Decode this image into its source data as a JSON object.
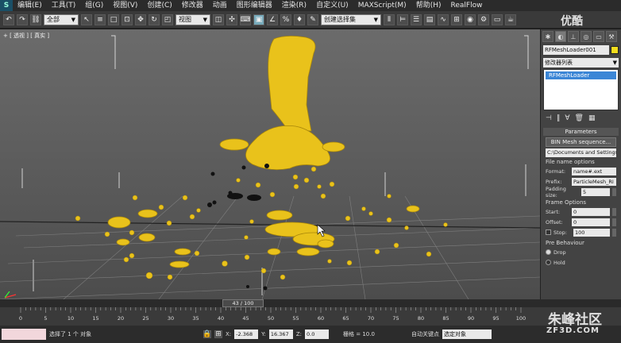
{
  "app": {
    "icon_letter": "S"
  },
  "menu": [
    "编辑(E)",
    "工具(T)",
    "组(G)",
    "视图(V)",
    "创建(C)",
    "修改器",
    "动画",
    "图形编辑器",
    "渲染(R)",
    "自定义(U)",
    "MAXScript(M)",
    "帮助(H)",
    "RealFlow"
  ],
  "toolbar": {
    "selection_filter": "全部",
    "reference_coord": "视图",
    "named_selection": "创建选择集"
  },
  "viewport": {
    "label": "+ [ 透视 ] [ 真实 ]"
  },
  "command_panel": {
    "object_name": "RFMeshLoader001",
    "object_color": "#f3dd1d",
    "modifier_list": "修改器列表",
    "stack_item": "RFMeshLoader",
    "rollout_title": "Parameters",
    "bin_button": "BIN Mesh sequence...",
    "path": "C:\\Documents and Settings",
    "file_name_group": "File name options",
    "format_label": "Format:",
    "format_value": "name#.ext",
    "prefix_label": "Prefix:",
    "prefix_value": "ParticleMesh_RI",
    "padding_label": "Padding size:",
    "padding_value": "5",
    "frame_options_group": "Frame Options",
    "start_label": "Start:",
    "start_value": "0",
    "offset_label": "Offset:",
    "offset_value": "0",
    "stop_label": "Stop:",
    "stop_value": "100",
    "pre_behaviour_group": "Pre Behaviour",
    "drop_label": "Drop",
    "hold_label": "Hold"
  },
  "timeline": {
    "slider_text": "43 / 100",
    "ticks": [
      "0",
      "5",
      "10",
      "15",
      "20",
      "25",
      "30",
      "35",
      "40",
      "45",
      "50",
      "55",
      "60",
      "65",
      "70",
      "75",
      "80",
      "85",
      "90",
      "95",
      "100"
    ]
  },
  "status": {
    "message": "选择了 1 个 对象",
    "x_label": "X:",
    "x_value": "-2.368",
    "y_label": "Y:",
    "y_value": "16.367",
    "z_label": "Z:",
    "z_value": "0.0",
    "grid": "栅格 = 10.0",
    "autokey": "自动关键点",
    "selected_dropdown": "选定对象"
  },
  "watermarks": {
    "top": "优酷",
    "bottom_cn": "朱峰社区",
    "bottom_url": "ZF3D.COM"
  }
}
